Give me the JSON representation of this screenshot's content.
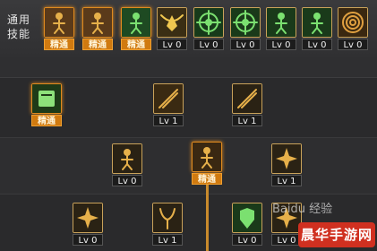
{
  "common_skills_label": "通用\n技能",
  "top_slots": [
    {
      "icon": "figure-rest-icon",
      "tag": "精通",
      "tag_style": "master",
      "frame": "orange",
      "fg": "#e6b04a",
      "bg": "#5a3a1a"
    },
    {
      "icon": "figure-crouch-icon",
      "tag": "精通",
      "tag_style": "master",
      "frame": "orange",
      "fg": "#e6b04a",
      "bg": "#5a3a1a"
    },
    {
      "icon": "figure-dash-icon",
      "tag": "精通",
      "tag_style": "master",
      "frame": "orange",
      "fg": "#7be070",
      "bg": "#1e4a22"
    },
    {
      "icon": "wings-emblem-icon",
      "tag": "Lv 0",
      "tag_style": "level",
      "frame": "gold",
      "fg": "#f0c850",
      "bg": "#3a2e14"
    },
    {
      "icon": "target-icon",
      "tag": "Lv 0",
      "tag_style": "level",
      "frame": "gold",
      "fg": "#7be070",
      "bg": "#173a1a"
    },
    {
      "icon": "crosshair-icon",
      "tag": "Lv 0",
      "tag_style": "level",
      "frame": "gold",
      "fg": "#7be070",
      "bg": "#1a3a1a"
    },
    {
      "icon": "figure-shoot-icon",
      "tag": "Lv 0",
      "tag_style": "level",
      "frame": "gold",
      "fg": "#7be070",
      "bg": "#1a3a1a"
    },
    {
      "icon": "figure-lean-icon",
      "tag": "Lv 0",
      "tag_style": "level",
      "frame": "gold",
      "fg": "#7be070",
      "bg": "#1a3a1a"
    },
    {
      "icon": "spiral-icon",
      "tag": "Lv 0",
      "tag_style": "level",
      "frame": "gold",
      "fg": "#e0a040",
      "bg": "#3a2810"
    }
  ],
  "tree_slots": [
    {
      "icon": "book-icon",
      "tag": "精通",
      "tag_style": "master",
      "frame": "orange",
      "fg": "#8de07a",
      "bg": "#1e3a18"
    },
    {
      "icon": "blade-icon",
      "tag": "Lv 1",
      "tag_style": "level",
      "frame": "gold",
      "fg": "#e6b04a",
      "bg": "#3a2a12"
    },
    {
      "icon": "slash-icon",
      "tag": "Lv 1",
      "tag_style": "level",
      "frame": "gold",
      "fg": "#e6b04a",
      "bg": "#2a2214"
    },
    {
      "icon": "fist-icon",
      "tag": "Lv 0",
      "tag_style": "level",
      "frame": "gold",
      "fg": "#e6b04a",
      "bg": "#2a2214"
    },
    {
      "icon": "warrior-icon",
      "tag": "精通",
      "tag_style": "master",
      "frame": "orange",
      "fg": "#e6b04a",
      "bg": "#3a2812"
    },
    {
      "icon": "burst-icon",
      "tag": "Lv 1",
      "tag_style": "level",
      "frame": "gold",
      "fg": "#e6b04a",
      "bg": "#2a2214"
    },
    {
      "icon": "shatter-icon",
      "tag": "Lv 0",
      "tag_style": "level",
      "frame": "gold",
      "fg": "#e6b04a",
      "bg": "#2a2214"
    },
    {
      "icon": "horned-icon",
      "tag": "Lv 1",
      "tag_style": "level",
      "frame": "gold",
      "fg": "#e6b04a",
      "bg": "#2a2214"
    },
    {
      "icon": "armor-icon",
      "tag": "Lv 0",
      "tag_style": "level",
      "frame": "gold",
      "fg": "#7be070",
      "bg": "#1a3a1a"
    },
    {
      "icon": "claw-icon",
      "tag": "Lv 0",
      "tag_style": "level",
      "frame": "gold",
      "fg": "#e6b04a",
      "bg": "#2a2214"
    }
  ],
  "watermark": "Baidu 经验",
  "site_logo": "晨华手游网"
}
